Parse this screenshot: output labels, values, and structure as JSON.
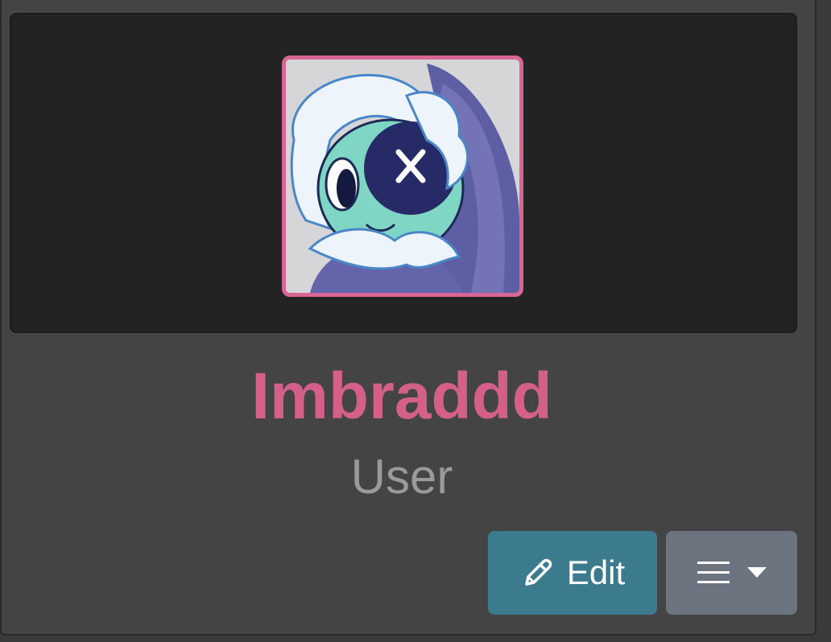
{
  "profile": {
    "username": "Imbraddd",
    "role": "User",
    "avatar_alt": "User avatar illustration"
  },
  "actions": {
    "edit_label": "Edit",
    "menu_icon": "hamburger-icon",
    "menu_caret": "caret-down-icon"
  },
  "colors": {
    "username": "#d4608a",
    "avatar_border": "#d86593",
    "edit_button": "#3c7b8d",
    "menu_button": "#6c7480"
  }
}
